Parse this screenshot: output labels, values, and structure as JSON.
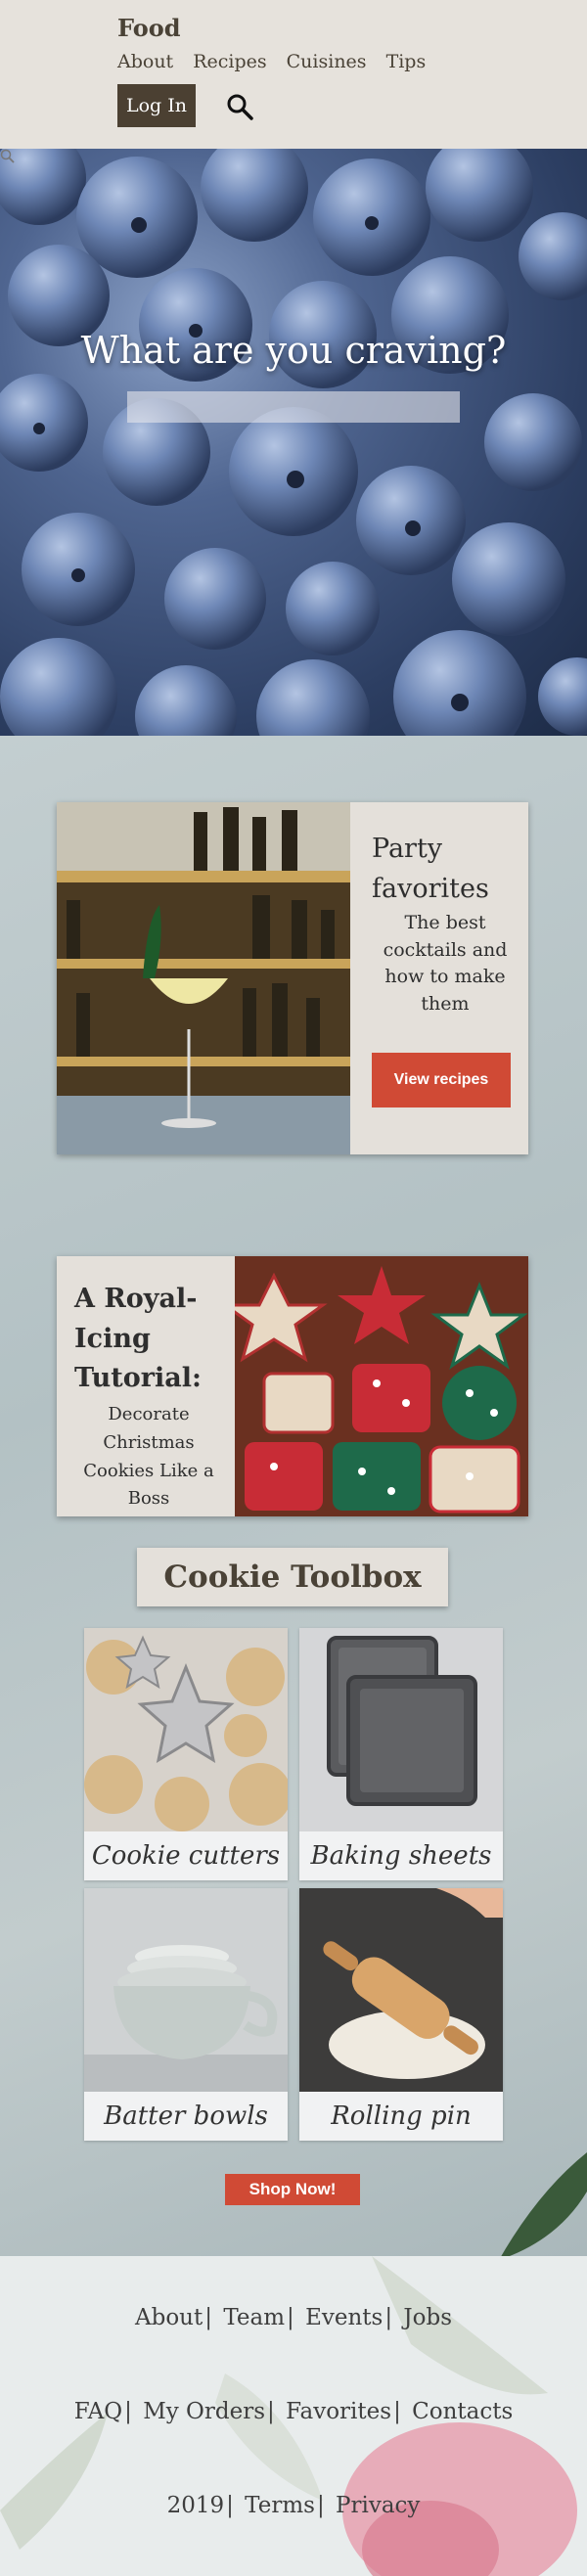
{
  "header": {
    "brand": "Food",
    "nav": [
      "About",
      "Recipes",
      "Cuisines",
      "Tips"
    ],
    "login_label": "Log In",
    "search_icon": "search-icon"
  },
  "hero": {
    "title": "What are you craving?",
    "search_placeholder": ""
  },
  "feature_party": {
    "title": "Party favorites",
    "subtitle": "The best cocktails and how to make them",
    "button_label": "View recipes"
  },
  "feature_icing": {
    "title": "A Royal-Icing Tutorial:",
    "subtitle": "Decorate Christmas Cookies Like a Boss"
  },
  "toolbox": {
    "title": "Cookie Toolbox",
    "items": [
      {
        "label": "Cookie cutters"
      },
      {
        "label": "Baking sheets"
      },
      {
        "label": "Batter bowls"
      },
      {
        "label": "Rolling pin"
      }
    ],
    "shop_label": "Shop Now!"
  },
  "footer": {
    "row1": [
      "About",
      "Team",
      "Events",
      "Jobs"
    ],
    "row2": [
      "FAQ",
      "My Orders",
      "Favorites",
      "Contacts"
    ],
    "row3": [
      "2019",
      "Terms",
      "Privacy"
    ],
    "separator": "|"
  },
  "colors": {
    "header_bg": "#e6e2dc",
    "brand_dark": "#4b4032",
    "accent_red": "#d04a35",
    "card_bg": "#e4e0da"
  }
}
